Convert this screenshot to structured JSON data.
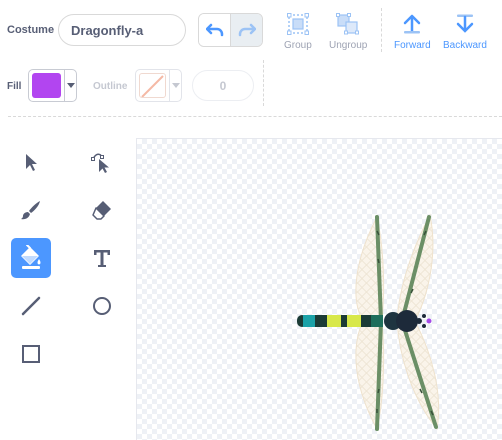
{
  "costume": {
    "label": "Costume",
    "name": "Dragonfly-a"
  },
  "toolbar": {
    "group": "Group",
    "ungroup": "Ungroup",
    "forward": "Forward",
    "backward": "Backward"
  },
  "fill": {
    "label": "Fill",
    "color": "#b245f0"
  },
  "outline": {
    "label": "Outline",
    "width": "0"
  },
  "tools": [
    {
      "name": "select",
      "icon": "arrow-select-icon",
      "active": false
    },
    {
      "name": "reshape",
      "icon": "reshape-icon",
      "active": false
    },
    {
      "name": "brush",
      "icon": "brush-icon",
      "active": false
    },
    {
      "name": "eraser",
      "icon": "eraser-icon",
      "active": false
    },
    {
      "name": "fill",
      "icon": "paint-bucket-icon",
      "active": true
    },
    {
      "name": "text",
      "icon": "text-icon",
      "active": false
    },
    {
      "name": "line",
      "icon": "line-icon",
      "active": false
    },
    {
      "name": "circle",
      "icon": "circle-icon",
      "active": false
    },
    {
      "name": "rectangle",
      "icon": "rectangle-icon",
      "active": false
    }
  ],
  "colors": {
    "accent": "#4c97ff",
    "text": "#575e75",
    "disabled": "#9ea3b3"
  }
}
